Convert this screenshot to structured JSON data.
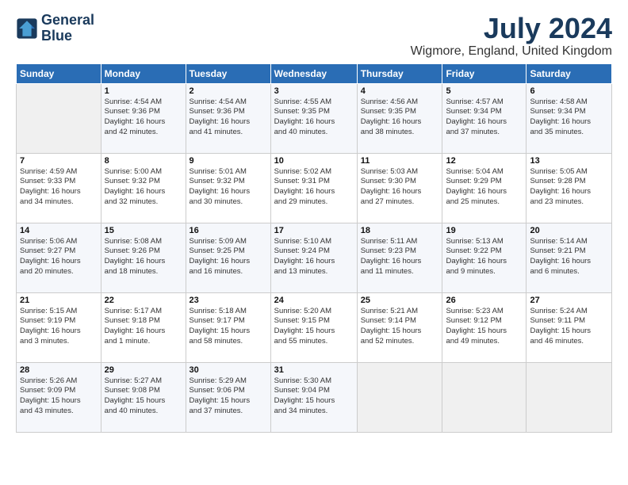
{
  "logo": {
    "line1": "General",
    "line2": "Blue"
  },
  "title": "July 2024",
  "location": "Wigmore, England, United Kingdom",
  "days_header": [
    "Sunday",
    "Monday",
    "Tuesday",
    "Wednesday",
    "Thursday",
    "Friday",
    "Saturday"
  ],
  "weeks": [
    [
      {
        "day": "",
        "info": ""
      },
      {
        "day": "1",
        "info": "Sunrise: 4:54 AM\nSunset: 9:36 PM\nDaylight: 16 hours\nand 42 minutes."
      },
      {
        "day": "2",
        "info": "Sunrise: 4:54 AM\nSunset: 9:36 PM\nDaylight: 16 hours\nand 41 minutes."
      },
      {
        "day": "3",
        "info": "Sunrise: 4:55 AM\nSunset: 9:35 PM\nDaylight: 16 hours\nand 40 minutes."
      },
      {
        "day": "4",
        "info": "Sunrise: 4:56 AM\nSunset: 9:35 PM\nDaylight: 16 hours\nand 38 minutes."
      },
      {
        "day": "5",
        "info": "Sunrise: 4:57 AM\nSunset: 9:34 PM\nDaylight: 16 hours\nand 37 minutes."
      },
      {
        "day": "6",
        "info": "Sunrise: 4:58 AM\nSunset: 9:34 PM\nDaylight: 16 hours\nand 35 minutes."
      }
    ],
    [
      {
        "day": "7",
        "info": "Sunrise: 4:59 AM\nSunset: 9:33 PM\nDaylight: 16 hours\nand 34 minutes."
      },
      {
        "day": "8",
        "info": "Sunrise: 5:00 AM\nSunset: 9:32 PM\nDaylight: 16 hours\nand 32 minutes."
      },
      {
        "day": "9",
        "info": "Sunrise: 5:01 AM\nSunset: 9:32 PM\nDaylight: 16 hours\nand 30 minutes."
      },
      {
        "day": "10",
        "info": "Sunrise: 5:02 AM\nSunset: 9:31 PM\nDaylight: 16 hours\nand 29 minutes."
      },
      {
        "day": "11",
        "info": "Sunrise: 5:03 AM\nSunset: 9:30 PM\nDaylight: 16 hours\nand 27 minutes."
      },
      {
        "day": "12",
        "info": "Sunrise: 5:04 AM\nSunset: 9:29 PM\nDaylight: 16 hours\nand 25 minutes."
      },
      {
        "day": "13",
        "info": "Sunrise: 5:05 AM\nSunset: 9:28 PM\nDaylight: 16 hours\nand 23 minutes."
      }
    ],
    [
      {
        "day": "14",
        "info": "Sunrise: 5:06 AM\nSunset: 9:27 PM\nDaylight: 16 hours\nand 20 minutes."
      },
      {
        "day": "15",
        "info": "Sunrise: 5:08 AM\nSunset: 9:26 PM\nDaylight: 16 hours\nand 18 minutes."
      },
      {
        "day": "16",
        "info": "Sunrise: 5:09 AM\nSunset: 9:25 PM\nDaylight: 16 hours\nand 16 minutes."
      },
      {
        "day": "17",
        "info": "Sunrise: 5:10 AM\nSunset: 9:24 PM\nDaylight: 16 hours\nand 13 minutes."
      },
      {
        "day": "18",
        "info": "Sunrise: 5:11 AM\nSunset: 9:23 PM\nDaylight: 16 hours\nand 11 minutes."
      },
      {
        "day": "19",
        "info": "Sunrise: 5:13 AM\nSunset: 9:22 PM\nDaylight: 16 hours\nand 9 minutes."
      },
      {
        "day": "20",
        "info": "Sunrise: 5:14 AM\nSunset: 9:21 PM\nDaylight: 16 hours\nand 6 minutes."
      }
    ],
    [
      {
        "day": "21",
        "info": "Sunrise: 5:15 AM\nSunset: 9:19 PM\nDaylight: 16 hours\nand 3 minutes."
      },
      {
        "day": "22",
        "info": "Sunrise: 5:17 AM\nSunset: 9:18 PM\nDaylight: 16 hours\nand 1 minute."
      },
      {
        "day": "23",
        "info": "Sunrise: 5:18 AM\nSunset: 9:17 PM\nDaylight: 15 hours\nand 58 minutes."
      },
      {
        "day": "24",
        "info": "Sunrise: 5:20 AM\nSunset: 9:15 PM\nDaylight: 15 hours\nand 55 minutes."
      },
      {
        "day": "25",
        "info": "Sunrise: 5:21 AM\nSunset: 9:14 PM\nDaylight: 15 hours\nand 52 minutes."
      },
      {
        "day": "26",
        "info": "Sunrise: 5:23 AM\nSunset: 9:12 PM\nDaylight: 15 hours\nand 49 minutes."
      },
      {
        "day": "27",
        "info": "Sunrise: 5:24 AM\nSunset: 9:11 PM\nDaylight: 15 hours\nand 46 minutes."
      }
    ],
    [
      {
        "day": "28",
        "info": "Sunrise: 5:26 AM\nSunset: 9:09 PM\nDaylight: 15 hours\nand 43 minutes."
      },
      {
        "day": "29",
        "info": "Sunrise: 5:27 AM\nSunset: 9:08 PM\nDaylight: 15 hours\nand 40 minutes."
      },
      {
        "day": "30",
        "info": "Sunrise: 5:29 AM\nSunset: 9:06 PM\nDaylight: 15 hours\nand 37 minutes."
      },
      {
        "day": "31",
        "info": "Sunrise: 5:30 AM\nSunset: 9:04 PM\nDaylight: 15 hours\nand 34 minutes."
      },
      {
        "day": "",
        "info": ""
      },
      {
        "day": "",
        "info": ""
      },
      {
        "day": "",
        "info": ""
      }
    ]
  ]
}
